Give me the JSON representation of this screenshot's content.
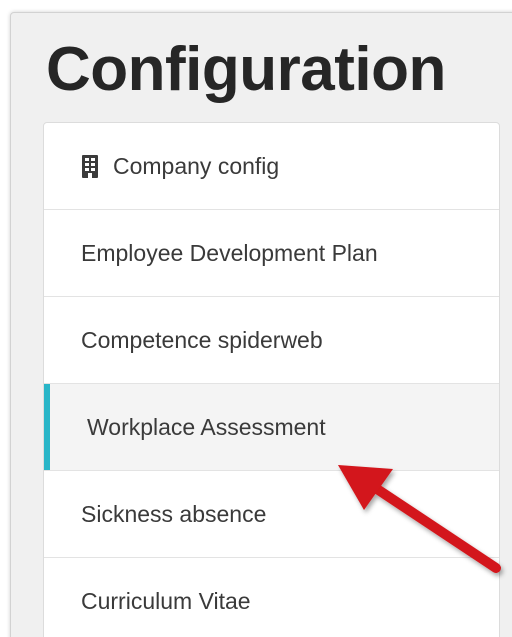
{
  "page": {
    "title": "Configuration"
  },
  "menu": {
    "items": [
      {
        "label": "Company config",
        "icon": "building-icon"
      },
      {
        "label": "Employee Development Plan"
      },
      {
        "label": "Competence spiderweb"
      },
      {
        "label": "Workplace Assessment",
        "active": true
      },
      {
        "label": "Sickness absence"
      },
      {
        "label": "Curriculum Vitae"
      }
    ]
  },
  "colors": {
    "active_indicator": "#29b6c8",
    "annotation_arrow": "#d3141a",
    "title_text": "#262626",
    "menu_text": "#3a3a3a"
  }
}
